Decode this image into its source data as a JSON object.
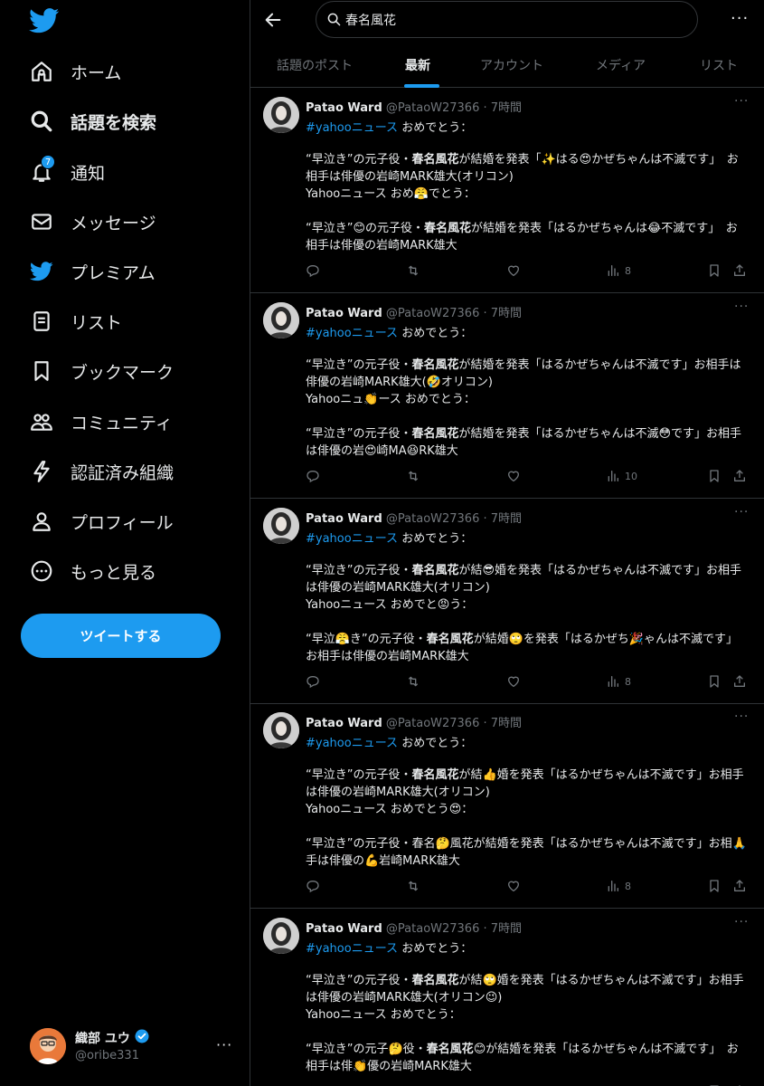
{
  "sidebar": {
    "logo_icon": "twitter-bird-icon",
    "nav": [
      {
        "label": "ホーム",
        "icon": "home-icon"
      },
      {
        "label": "話題を検索",
        "icon": "search-icon"
      },
      {
        "label": "通知",
        "icon": "bell-icon",
        "badge": "7"
      },
      {
        "label": "メッセージ",
        "icon": "mail-icon"
      },
      {
        "label": "プレミアム",
        "icon": "twitter-bird-icon"
      },
      {
        "label": "リスト",
        "icon": "list-icon"
      },
      {
        "label": "ブックマーク",
        "icon": "bookmark-icon"
      },
      {
        "label": "コミュニティ",
        "icon": "people-icon"
      },
      {
        "label": "認証済み組織",
        "icon": "lightning-icon"
      },
      {
        "label": "プロフィール",
        "icon": "person-icon"
      },
      {
        "label": "もっと見る",
        "icon": "more-circle-icon"
      }
    ],
    "tweet_button": "ツイートする",
    "account": {
      "name": "織部 ユウ",
      "handle": "@oribe331",
      "more": "···"
    }
  },
  "search": {
    "query": "春名風花",
    "more": "···"
  },
  "tabs": [
    "話題のポスト",
    "最新",
    "アカウント",
    "メディア",
    "リスト"
  ],
  "active_tab": 1,
  "colors": {
    "accent": "#1d9bf0",
    "background": "#000000",
    "text": "#e7e9ea",
    "muted": "#71767b",
    "border": "#2f3336"
  },
  "tweets": [
    {
      "name": "Patao Ward",
      "meta": "@PataoW27366 · 7時間",
      "hashtag": "#yahooニュース",
      "after_tag": " おめでとう：",
      "body": "“早泣き”の元子役・春名風花が結婚を発表「✨はる😍かぜちゃんは不滅です」　お相手は俳優の岩崎MARK雄大(オリコン)\nYahooニュース おめ😤でとう：\n\n“早泣き”😊の元子役・春名風花が結婚を発表「はるかぜちゃんは😂不滅です」　お相手は俳優の岩崎MARK雄大",
      "views": "8"
    },
    {
      "name": "Patao Ward",
      "meta": "@PataoW27366 · 7時間",
      "hashtag": "#yahooニュース",
      "after_tag": " おめでとう：",
      "body": "“早泣き”の元子役・春名風花が結婚を発表「はるかぜちゃんは不滅です」お相手は俳優の岩崎MARK雄大(🤣オリコン)\nYahooニュ👏ース おめでとう：\n\n“早泣き”の元子役・春名風花が結婚を発表「はるかぜちゃんは不滅😳です」お相手は俳優の岩😍崎MA😆RK雄大",
      "views": "10"
    },
    {
      "name": "Patao Ward",
      "meta": "@PataoW27366 · 7時間",
      "hashtag": "#yahooニュース",
      "after_tag": " おめでとう：",
      "body": "“早泣き”の元子役・春名風花が結😎婚を発表「はるかぜちゃんは不滅です」お相手は俳優の岩崎MARK雄大(オリコン)\nYahooニュース おめでと😡う：\n\n“早泣😤き”の元子役・春名風花が結婚🙄を発表「はるかぜち🎉ゃんは不滅です」　お相手は俳優の岩崎MARK雄大",
      "views": "8"
    },
    {
      "name": "Patao Ward",
      "meta": "@PataoW27366 · 7時間",
      "hashtag": "#yahooニュース",
      "after_tag": " おめでとう：",
      "body": "“早泣き”の元子役・春名風花が結👍婚を発表「はるかぜちゃんは不滅です」お相手は俳優の岩崎MARK雄大(オリコン)\nYahooニュース おめでとう😍：\n\n“早泣き”の元子役・春名🤔風花が結婚を発表「はるかぜちゃんは不滅です」お相🙏手は俳優の💪岩崎MARK雄大",
      "views": "8"
    },
    {
      "name": "Patao Ward",
      "meta": "@PataoW27366 · 7時間",
      "hashtag": "#yahooニュース",
      "after_tag": " おめでとう：",
      "body": "“早泣き”の元子役・春名風花が結🙄婚を発表「はるかぜちゃんは不滅です」お相手は俳優の岩崎MARK雄大(オリコン😉)\nYahooニュース おめでとう：\n\n“早泣き”の元子🤔役・春名風花😊が結婚を発表「はるかぜちゃんは不滅です」　お相手は俳👏優の岩崎MARK雄大",
      "views": ""
    }
  ],
  "tweet_more": "···"
}
